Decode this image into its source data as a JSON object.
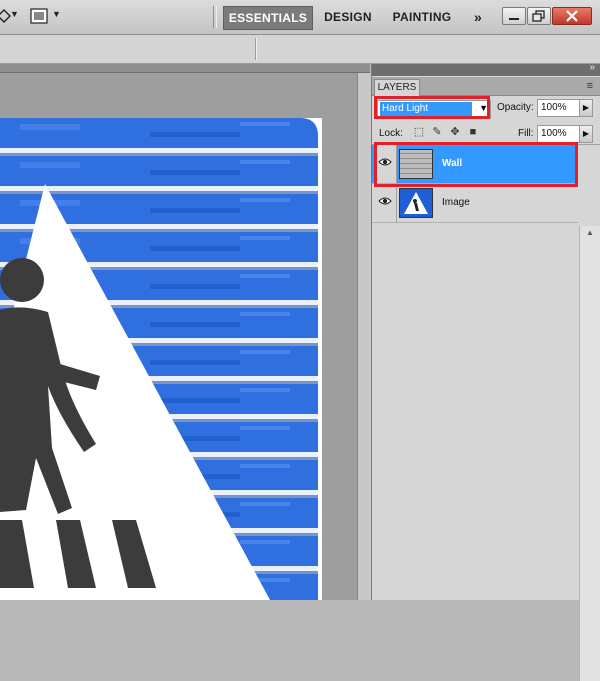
{
  "topbar": {
    "tools": [
      {
        "icon": "move-tool-icon"
      },
      {
        "icon": "screen-mode-icon"
      }
    ],
    "workspaces": [
      "ESSENTIALS",
      "DESIGN",
      "PAINTING"
    ],
    "more_glyph": "»",
    "active_workspace": "ESSENTIALS",
    "window_buttons": [
      "minimize-icon",
      "restore-icon",
      "close-icon"
    ]
  },
  "panel": {
    "tab": "LAYERS",
    "menu_glyph": "≡",
    "blend_mode": "Hard Light",
    "opacity_label": "Opacity:",
    "opacity_value": "100%",
    "lock_label": "Lock:",
    "fill_label": "Fill:",
    "fill_value": "100%",
    "layers": [
      {
        "name": "Wall",
        "selected": true,
        "visible": true
      },
      {
        "name": "Image",
        "selected": false,
        "visible": true
      }
    ]
  },
  "colors": {
    "selection": "#3399ff",
    "callout": "#e0202a",
    "sign_blue": "#2f6fe0"
  }
}
